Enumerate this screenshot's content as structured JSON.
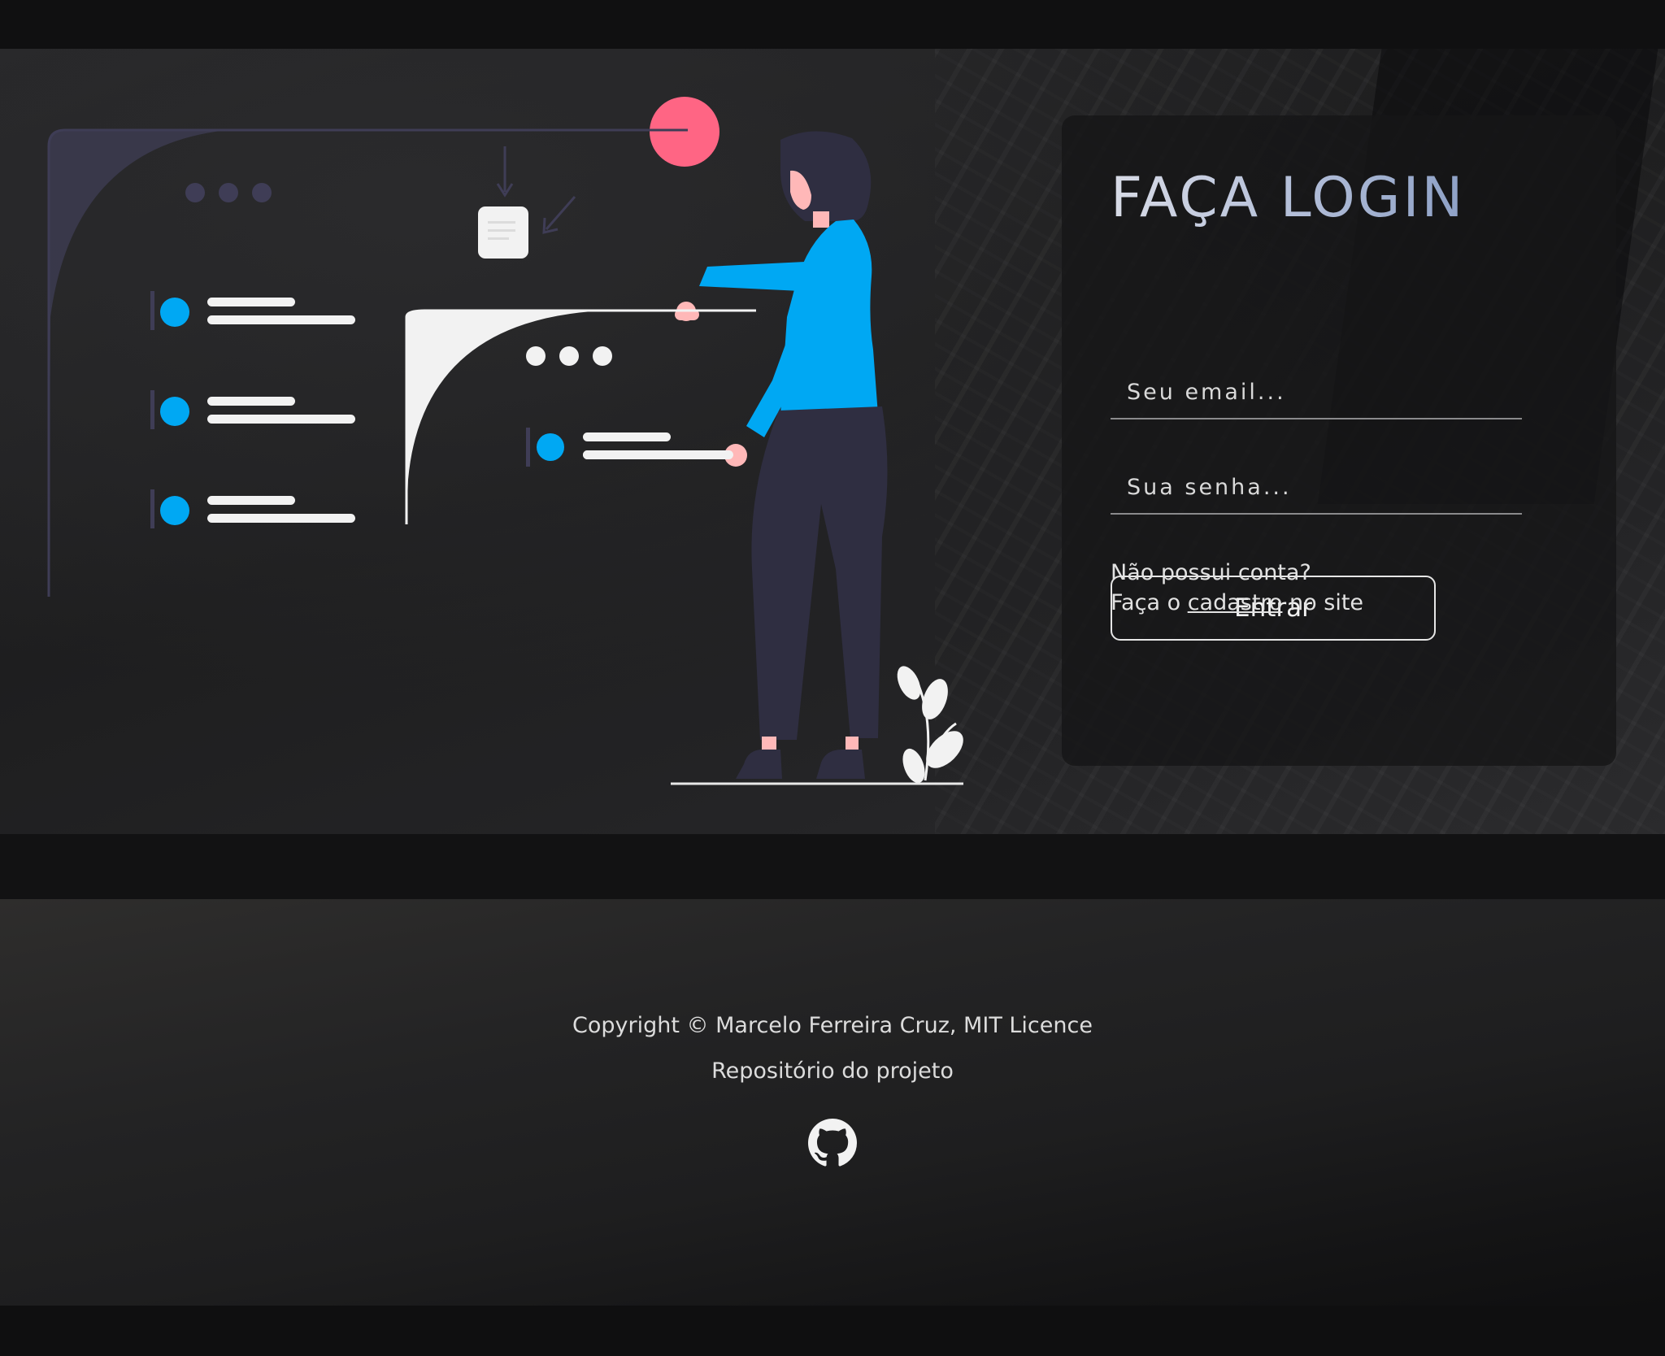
{
  "login": {
    "title": "FAÇA LOGIN",
    "email_placeholder": "Seu email...",
    "password_placeholder": "Sua senha...",
    "submit_label": "Entrar",
    "no_account_text": "Não possui conta?",
    "signup_prefix": "Faça o",
    "signup_link": "cadastro",
    "signup_suffix": "no site"
  },
  "footer": {
    "copyright": "Copyright © Marcelo Ferreira Cruz, MIT Licence",
    "repo_link": "Repositório do projeto",
    "github_icon": "github-icon"
  },
  "colors": {
    "accent_blue": "#00a8f3",
    "accent_pink": "#ff6584",
    "dark_purple": "#3f3d56",
    "figure_pants": "#2f2e41",
    "background": "#1e1e1f"
  }
}
